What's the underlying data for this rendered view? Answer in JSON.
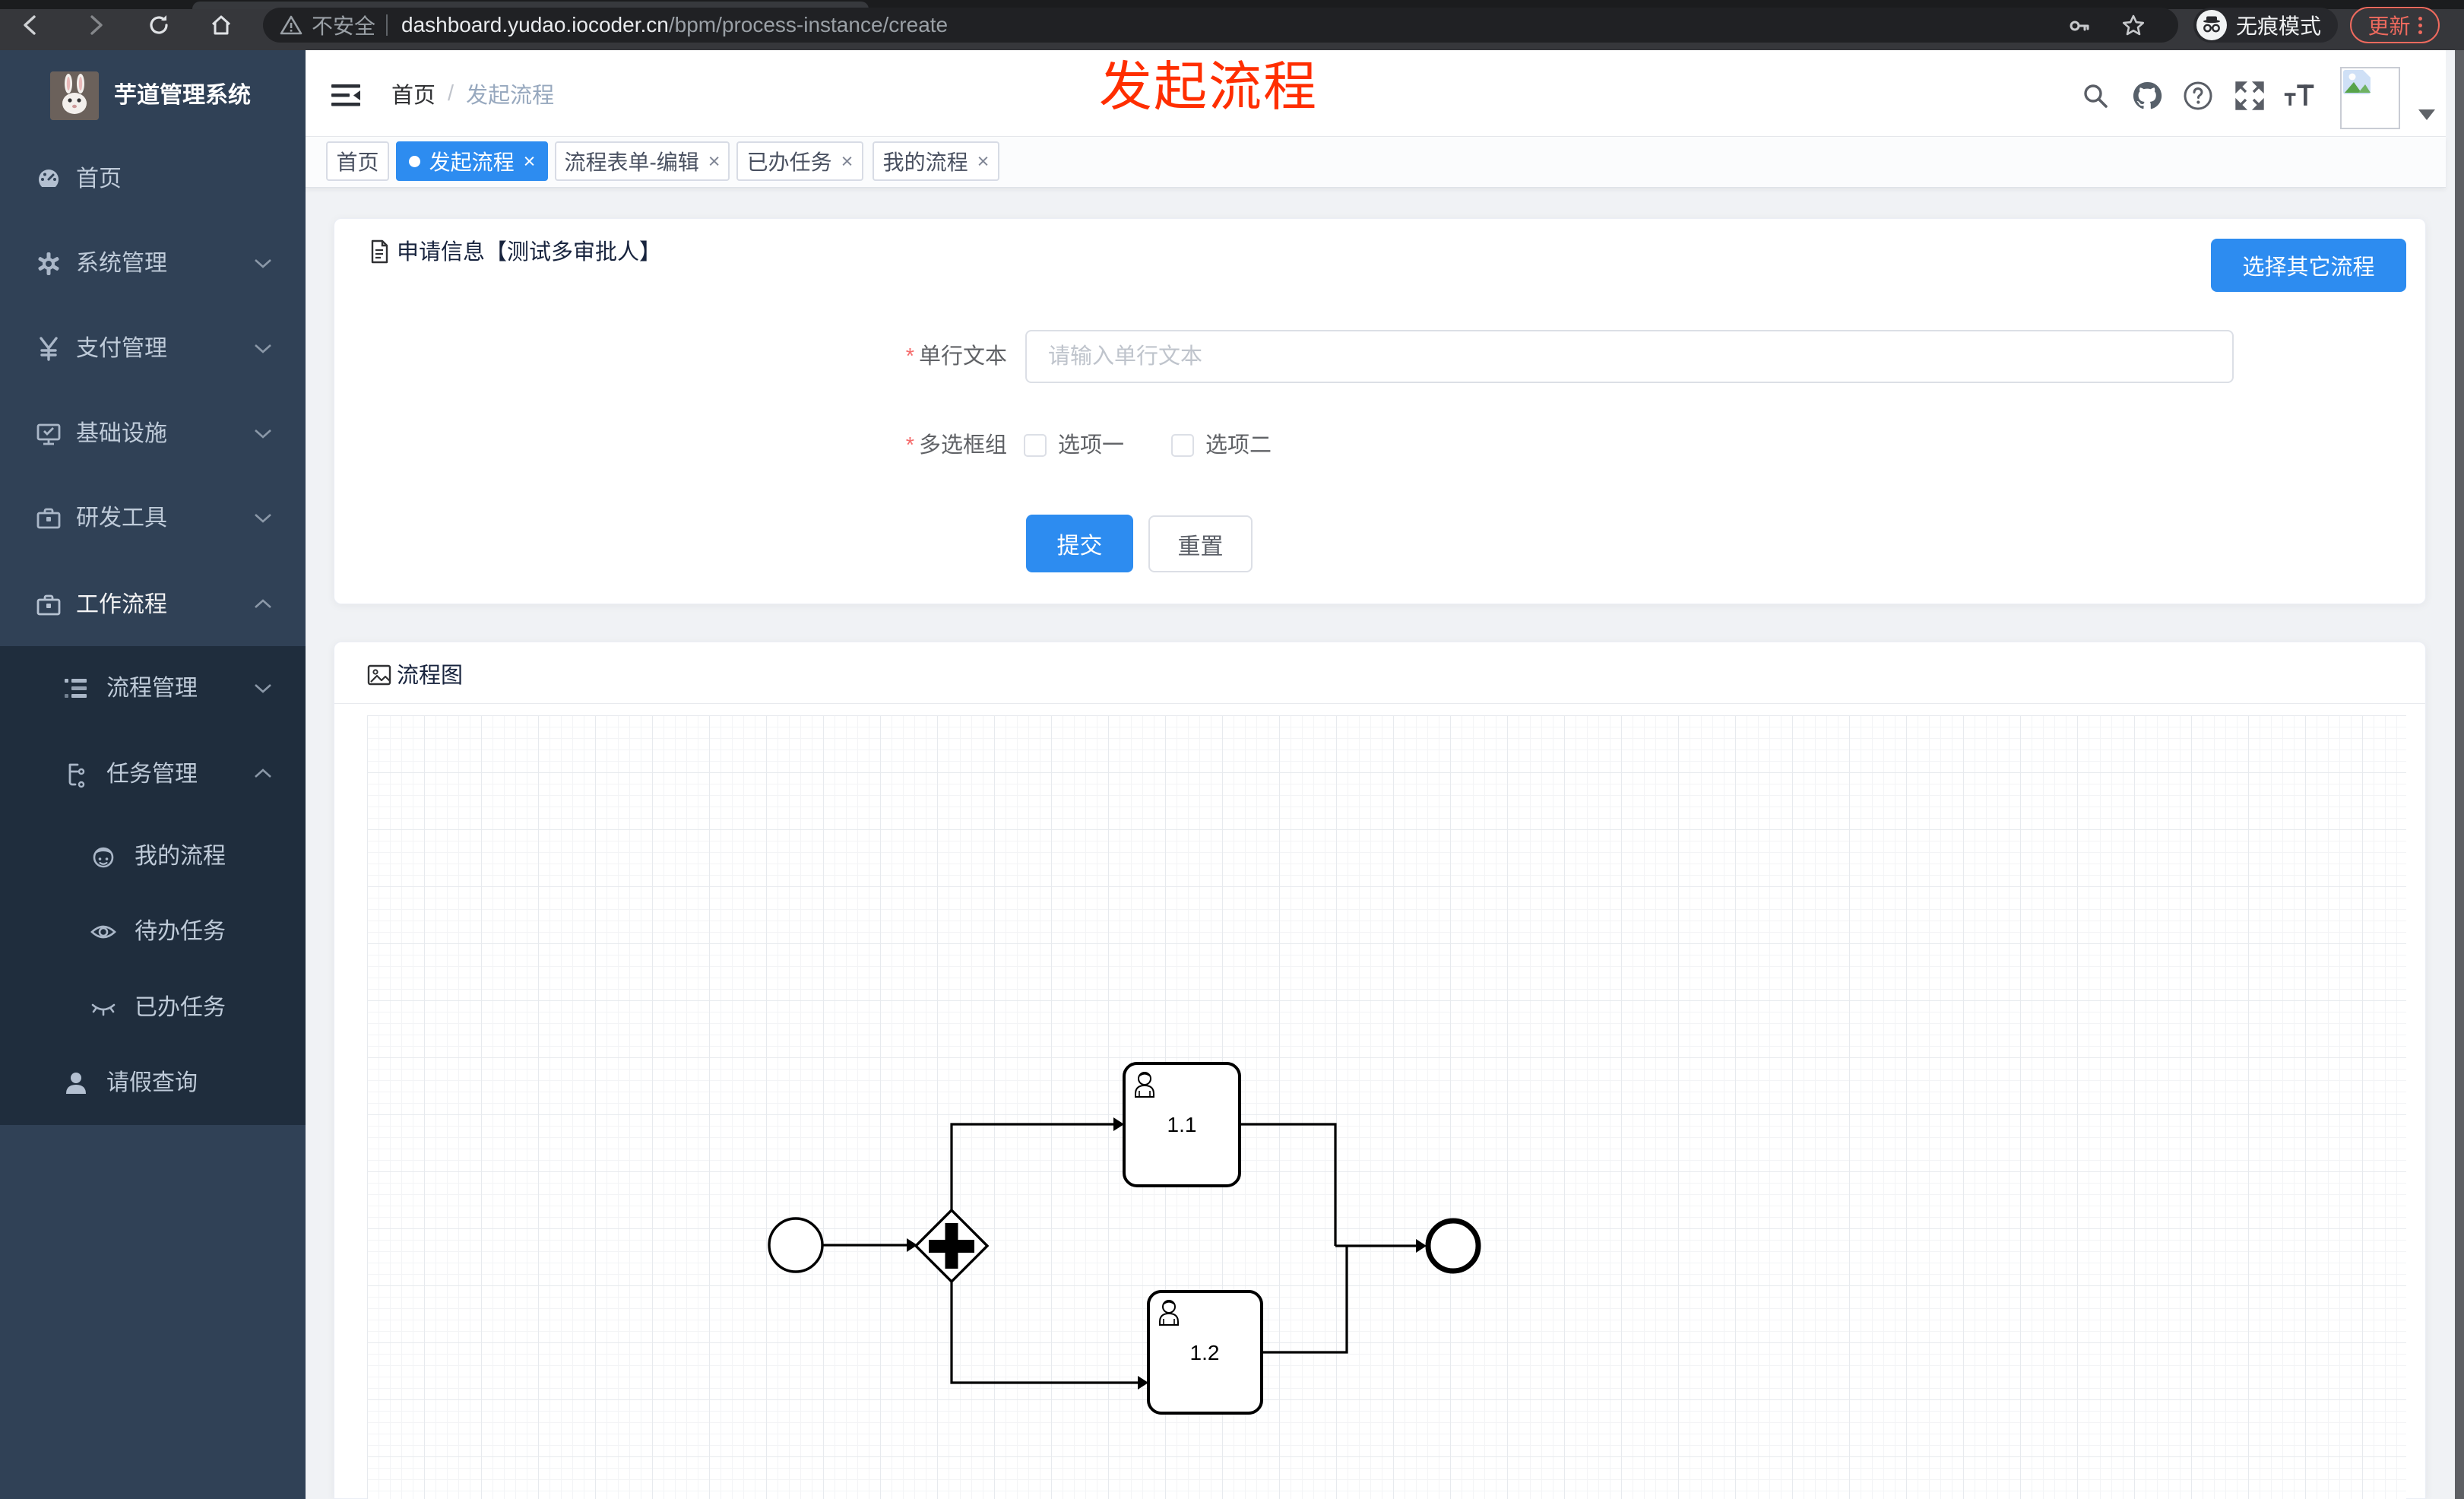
{
  "ui": {
    "close_glyph": "×",
    "breadcrumb_separator": "/"
  },
  "colors": {
    "accent": "#2d8cf0",
    "annotation": "#ff2e00",
    "sidebar_bg": "#304156",
    "sidebar_submenu_bg": "#1f2d3d",
    "chrome_bg": "#36373b",
    "update_accent": "#ef6a5e"
  },
  "browser": {
    "security_label": "不安全",
    "url_host": "dashboard.yudao.iocoder.cn",
    "url_path": "/bpm/process-instance/create",
    "incognito_label": "无痕模式",
    "update_label": "更新"
  },
  "annotation": {
    "text": "发起流程"
  },
  "sidebar": {
    "title": "芋道管理系统",
    "items": [
      {
        "label": "首页",
        "icon": "dashboard-icon",
        "level": 1
      },
      {
        "label": "系统管理",
        "icon": "gear-icon",
        "level": 1,
        "expand": "collapsed"
      },
      {
        "label": "支付管理",
        "icon": "yen-icon",
        "level": 1,
        "expand": "collapsed"
      },
      {
        "label": "基础设施",
        "icon": "monitor-icon",
        "level": 1,
        "expand": "collapsed"
      },
      {
        "label": "研发工具",
        "icon": "toolbox-icon",
        "level": 1,
        "expand": "collapsed"
      },
      {
        "label": "工作流程",
        "icon": "briefcase-icon",
        "level": 1,
        "expand": "expanded"
      },
      {
        "label": "流程管理",
        "icon": "tree-list-icon",
        "level": 2,
        "expand": "collapsed"
      },
      {
        "label": "任务管理",
        "icon": "flow-icon",
        "level": 2,
        "expand": "expanded"
      },
      {
        "label": "我的流程",
        "icon": "face-icon",
        "level": 3
      },
      {
        "label": "待办任务",
        "icon": "eye-open-icon",
        "level": 3
      },
      {
        "label": "已办任务",
        "icon": "eye-closed-icon",
        "level": 3
      },
      {
        "label": "请假查询",
        "icon": "user-icon",
        "level": 2
      }
    ]
  },
  "header": {
    "breadcrumb": [
      "首页",
      "发起流程"
    ]
  },
  "tabs": [
    {
      "label": "首页",
      "active": false,
      "closable": false
    },
    {
      "label": "发起流程",
      "active": true,
      "closable": true
    },
    {
      "label": "流程表单-编辑",
      "active": false,
      "closable": true
    },
    {
      "label": "已办任务",
      "active": false,
      "closable": true
    },
    {
      "label": "我的流程",
      "active": false,
      "closable": true
    }
  ],
  "form_card": {
    "title": "申请信息【测试多审批人】",
    "choose_other_button": "选择其它流程",
    "fields": [
      {
        "label": "单行文本",
        "required": true,
        "type": "text",
        "placeholder": "请输入单行文本",
        "value": ""
      },
      {
        "label": "多选框组",
        "required": true,
        "type": "checkbox-group",
        "options": [
          {
            "label": "选项一",
            "checked": false
          },
          {
            "label": "选项二",
            "checked": false
          }
        ]
      }
    ],
    "submit_button": "提交",
    "reset_button": "重置"
  },
  "flow_card": {
    "title": "流程图",
    "diagram": {
      "type": "bpmn",
      "nodes": [
        {
          "id": "StartEvent",
          "type": "start-event",
          "label": ""
        },
        {
          "id": "ParallelGateway",
          "type": "parallel-gateway",
          "label": ""
        },
        {
          "id": "UserTask_1",
          "type": "user-task",
          "label": "1.1"
        },
        {
          "id": "UserTask_2",
          "type": "user-task",
          "label": "1.2"
        },
        {
          "id": "EndEvent",
          "type": "end-event",
          "label": ""
        }
      ],
      "flows": [
        {
          "from": "StartEvent",
          "to": "ParallelGateway"
        },
        {
          "from": "ParallelGateway",
          "to": "UserTask_1"
        },
        {
          "from": "ParallelGateway",
          "to": "UserTask_2"
        },
        {
          "from": "UserTask_1",
          "to": "EndEvent"
        },
        {
          "from": "UserTask_2",
          "to": "EndEvent"
        }
      ]
    }
  }
}
